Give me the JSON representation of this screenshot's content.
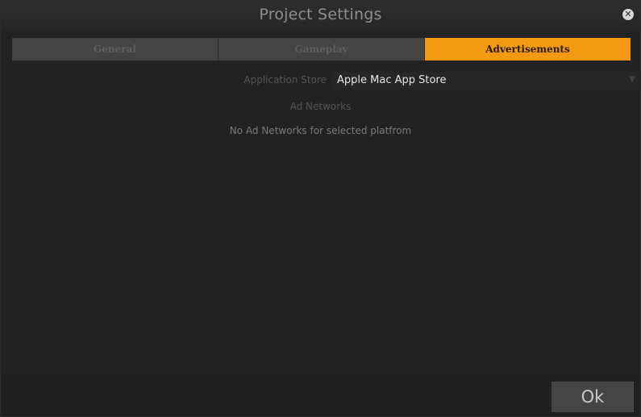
{
  "window": {
    "title": "Project Settings",
    "close_icon": "close-icon"
  },
  "tabs": [
    {
      "label": "General",
      "active": false
    },
    {
      "label": "Gameplay",
      "active": false
    },
    {
      "label": "Advertisements",
      "active": true
    }
  ],
  "store": {
    "label": "Application Store",
    "value": "Apple Mac App Store",
    "dropdown_icon": "chevron-down-icon"
  },
  "ad_networks": {
    "label": "Ad Networks",
    "empty_message": "No Ad Networks for selected platfrom"
  },
  "footer": {
    "ok_label": "Ok"
  },
  "colors": {
    "accent": "#f39a12",
    "background": "#222222"
  }
}
